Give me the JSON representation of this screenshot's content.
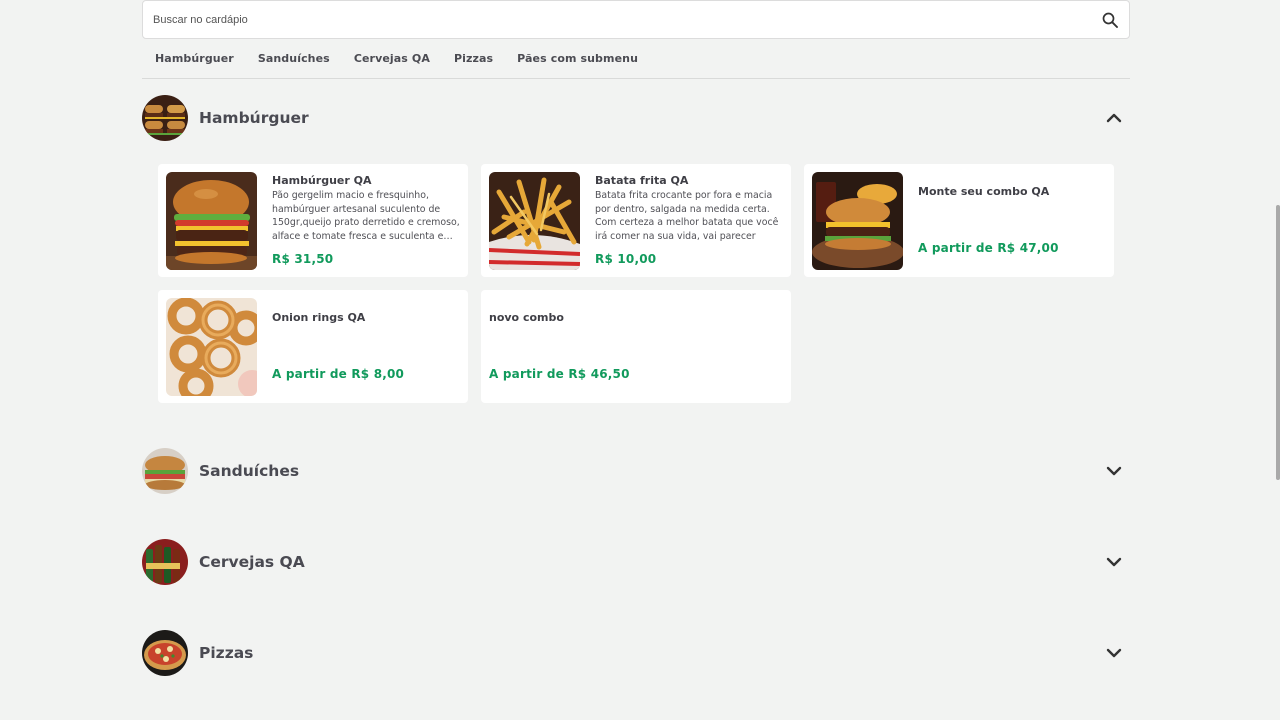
{
  "search": {
    "placeholder": "Buscar no cardápio",
    "value": ""
  },
  "nav": {
    "items": [
      "Hambúrguer",
      "Sanduíches",
      "Cervejas QA",
      "Pizzas",
      "Pães com submenu"
    ]
  },
  "sections": {
    "hamburguer": {
      "title": "Hambúrguer",
      "expanded": true,
      "products": [
        {
          "name": "Hambúrguer QA",
          "description": "Pão gergelim macio e fresquinho, hambúrguer artesanal suculento de 150gr,queijo prato derretido e cremoso, alface e tomate fresca e suculenta e…",
          "price": "R$ 31,50"
        },
        {
          "name": "Batata frita QA",
          "description": "Batata frita crocante por fora e macia por dentro, salgada na medida certa. Com certeza a melhor batata que você irá comer na sua vida, vai parecer até…",
          "price": "R$ 10,00"
        },
        {
          "name": "Monte seu combo QA",
          "description": "",
          "price": "A partir de R$ 47,00"
        },
        {
          "name": "Onion rings QA",
          "description": "",
          "price": "A partir de R$ 8,00"
        },
        {
          "name": "novo combo",
          "description": "",
          "price": "A partir de R$ 46,50"
        }
      ]
    },
    "sanduiches": {
      "title": "Sanduíches",
      "expanded": false
    },
    "cervejas": {
      "title": "Cervejas QA",
      "expanded": false
    },
    "pizzas": {
      "title": "Pizzas",
      "expanded": false
    }
  },
  "colors": {
    "background": "#f2f3f2",
    "price": "#119a5c",
    "text": "#3f3f46"
  },
  "icons": {
    "search": "search-icon",
    "expanded": "chevron-up-icon",
    "collapsed": "chevron-down-icon"
  }
}
